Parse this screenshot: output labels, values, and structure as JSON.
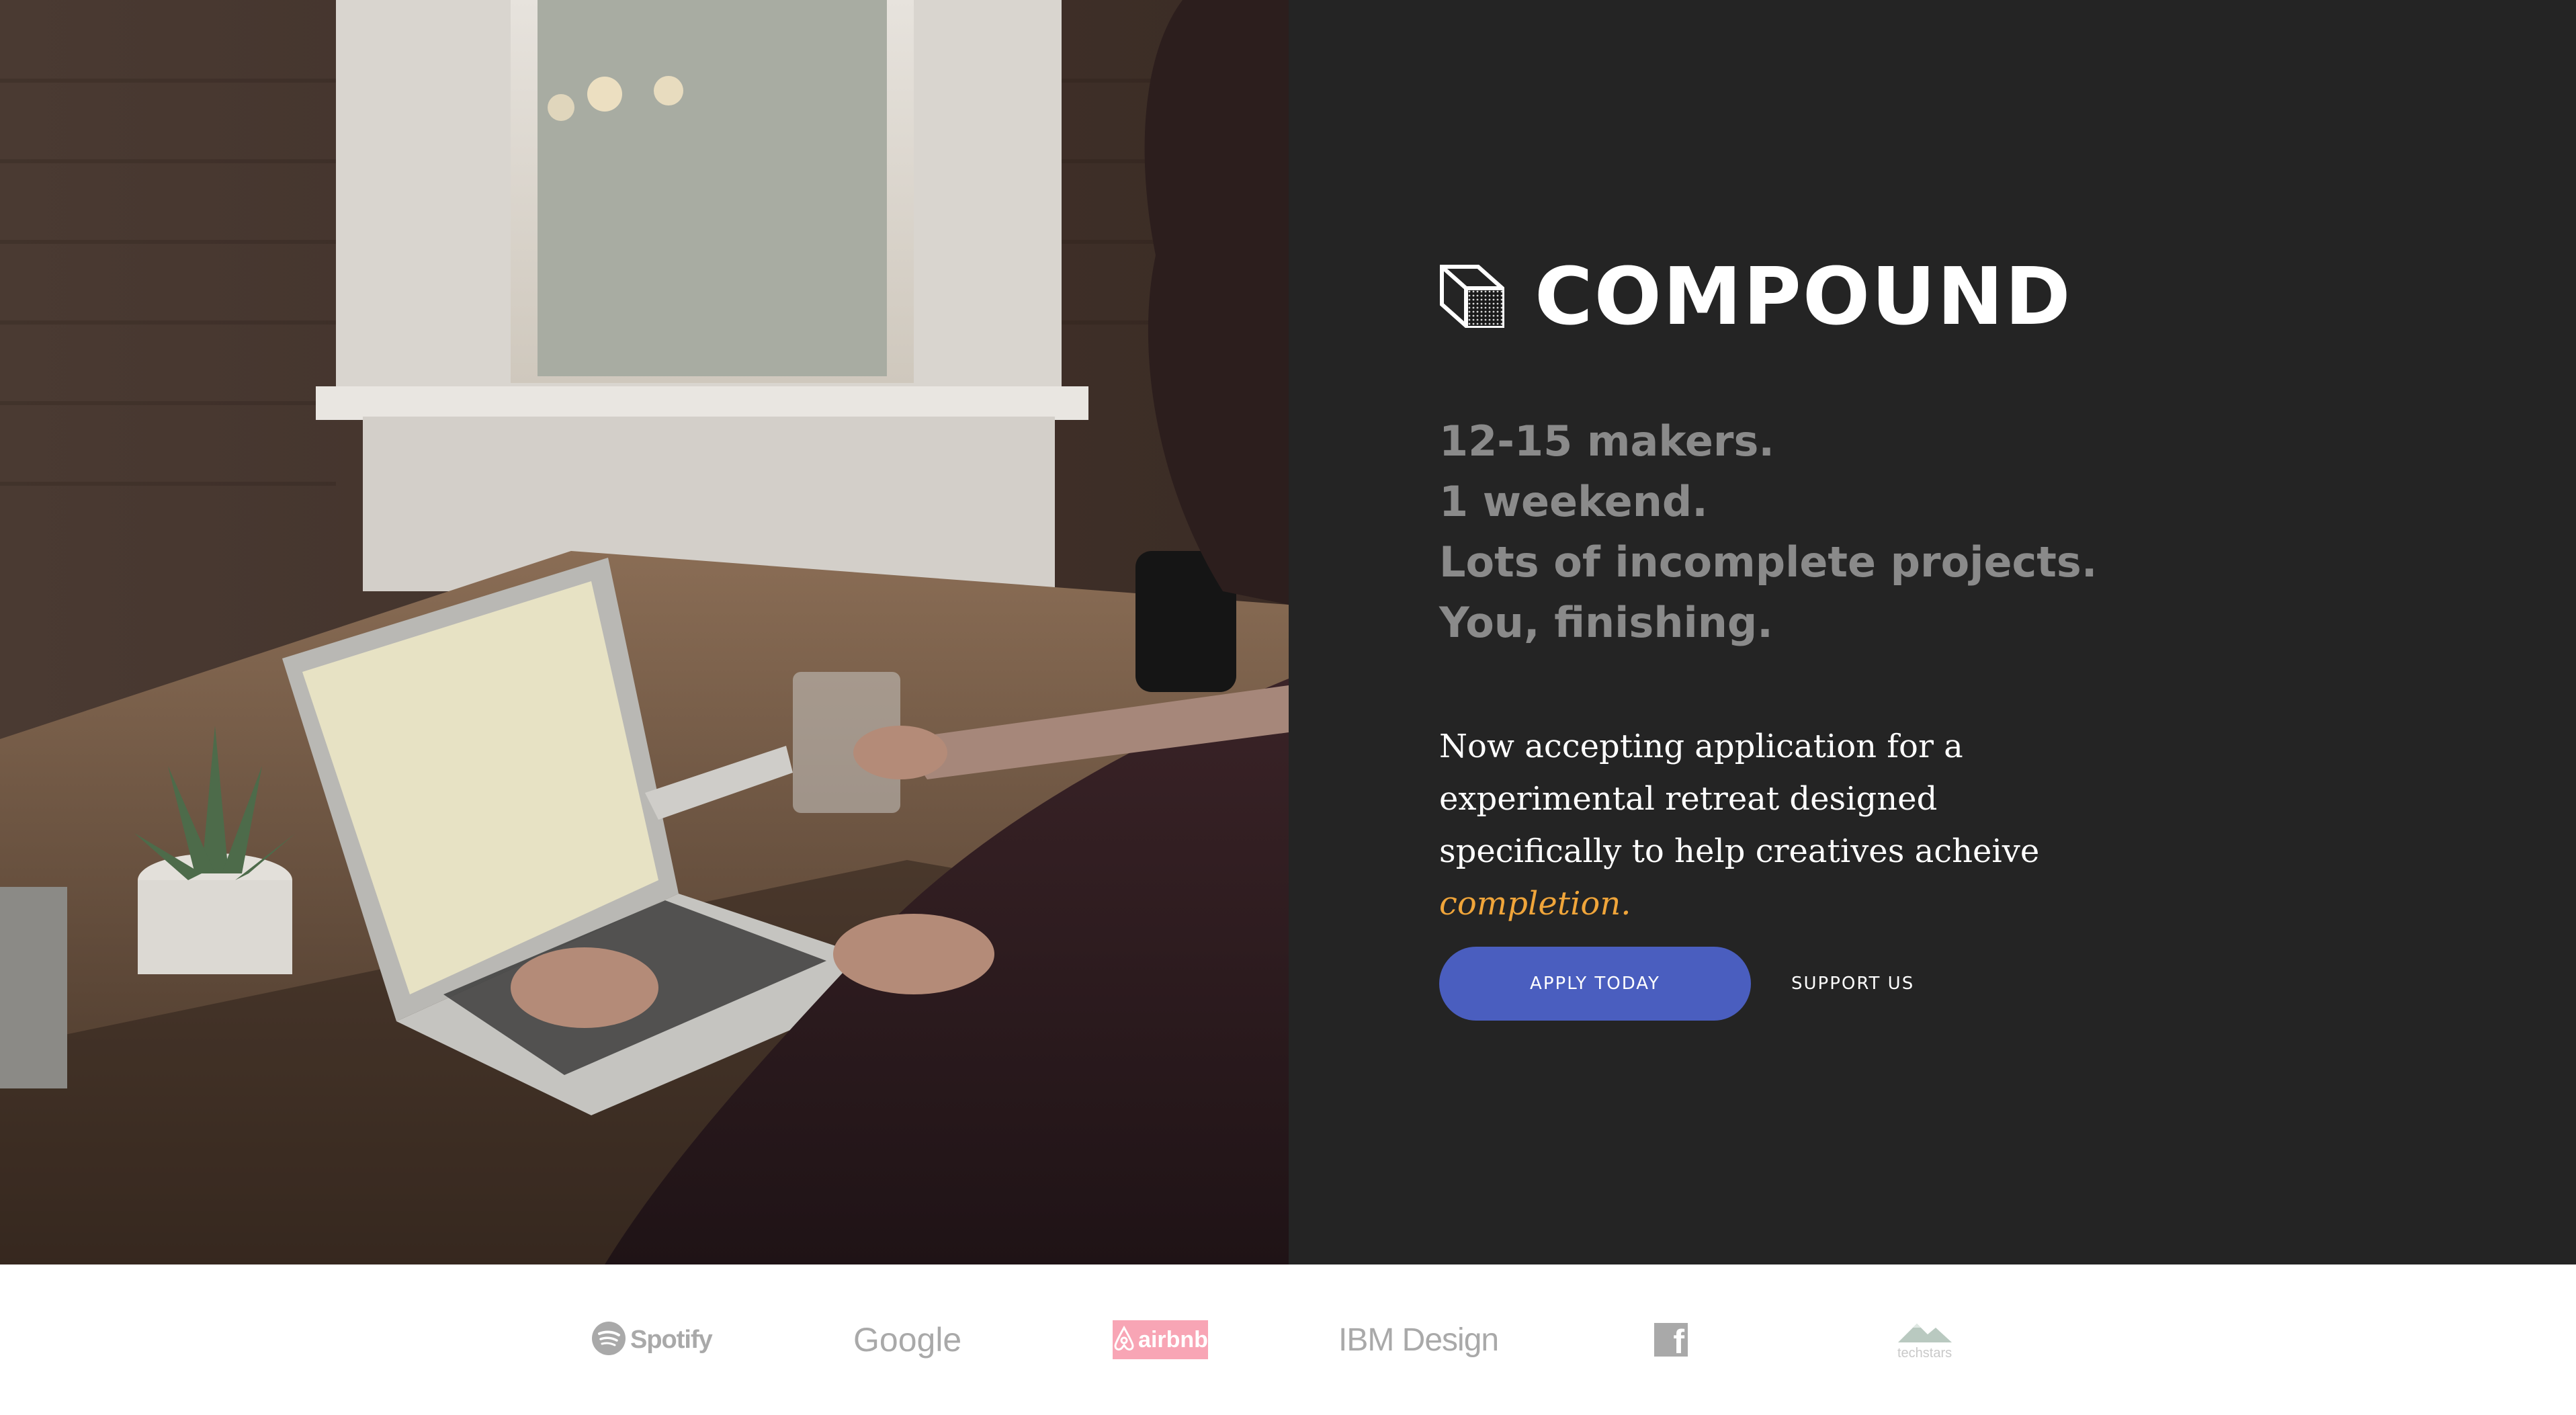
{
  "brand": {
    "name": "COMPOUND",
    "icon": "cube-logo-icon"
  },
  "hero": {
    "taglines": [
      "12-15 makers.",
      "1 weekend.",
      "Lots of incomplete projects.",
      "You, finishing."
    ],
    "description_prefix": "Now accepting application for a experimental retreat designed specifically to help creatives acheive ",
    "description_highlight": "completion.",
    "photo": "person-typing-on-laptop-photo"
  },
  "actions": {
    "apply_label": "APPLY TODAY",
    "support_label": "SUPPORT US"
  },
  "partners": {
    "spotify": "Spotify",
    "google": "Google",
    "airbnb": "airbnb",
    "ibm": "IBM Design",
    "facebook": "f",
    "techstars": "techstars"
  },
  "colors": {
    "panel_bg": "#242424",
    "accent_button": "#4a5ebf",
    "highlight": "#f0a53a",
    "tagline": "#8a8a8a",
    "airbnb_pink": "#f8a5b5"
  }
}
